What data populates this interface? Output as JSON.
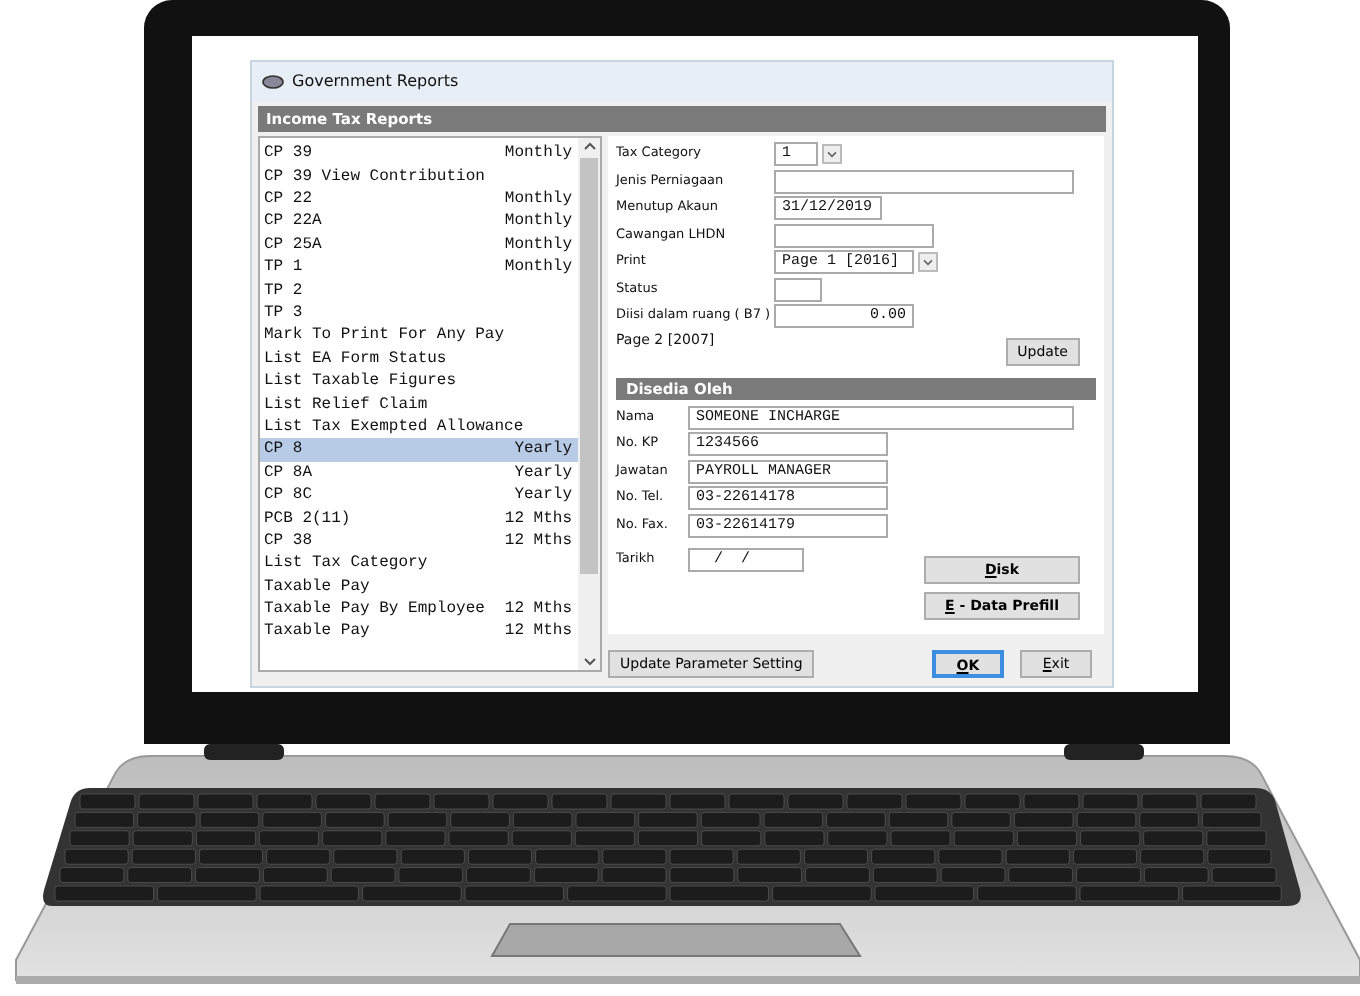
{
  "window": {
    "title": "Government Reports"
  },
  "section_title": "Income Tax Reports",
  "reports": [
    {
      "name": "CP 39",
      "period": "Monthly",
      "selected": false
    },
    {
      "name": "CP 39 View Contribution",
      "selected": false
    },
    {
      "name": "CP 22",
      "period": "Monthly",
      "selected": false
    },
    {
      "name": "CP 22A",
      "period": "Monthly",
      "selected": false
    },
    {
      "name": "CP 25A",
      "period": "Monthly",
      "selected": false
    },
    {
      "name": "TP 1",
      "period": "Monthly",
      "selected": false
    },
    {
      "name": "TP 2",
      "selected": false
    },
    {
      "name": "TP 3",
      "selected": false
    },
    {
      "name": "Mark To Print For Any Pay",
      "selected": false
    },
    {
      "name": "List EA Form Status",
      "selected": false
    },
    {
      "name": "List Taxable Figures",
      "selected": false
    },
    {
      "name": "List Relief Claim",
      "selected": false
    },
    {
      "name": "List Tax Exempted Allowance",
      "selected": false
    },
    {
      "name": "CP 8",
      "period": "Yearly",
      "selected": true
    },
    {
      "name": "CP 8A",
      "period": "Yearly",
      "selected": false
    },
    {
      "name": "CP 8C",
      "period": "Yearly",
      "selected": false
    },
    {
      "name": "PCB 2(11)",
      "period": "12 Mths",
      "selected": false
    },
    {
      "name": "CP 38",
      "period": "12 Mths",
      "selected": false
    },
    {
      "name": "List Tax Category",
      "selected": false
    },
    {
      "name": "Taxable Pay",
      "selected": false
    },
    {
      "name": "Taxable Pay By Employee",
      "period": "12 Mths",
      "selected": false
    },
    {
      "name": "Taxable Pay",
      "period": "12 Mths",
      "selected": false
    }
  ],
  "tax_fields": [
    {
      "label": "Tax Category",
      "kind": "dropdown",
      "value": "1"
    },
    {
      "label": "Jenis Perniagaan",
      "kind": "text"
    },
    {
      "label": "Menutup Akaun",
      "kind": "text",
      "value": "31/12/2019"
    },
    {
      "label": "Cawangan LHDN",
      "kind": "text"
    },
    {
      "label": "Print",
      "kind": "dropdown",
      "value": "Page 1 [2016]"
    },
    {
      "label": "Status",
      "kind": "text"
    },
    {
      "label": "Diisi dalam ruang ( B7 )",
      "kind": "number",
      "value": "0.00"
    }
  ],
  "page_note": "Page 2 [2007]",
  "update_button": "Update",
  "prepared_by": {
    "title": "Disedia Oleh",
    "fields": [
      {
        "label": "Nama",
        "value": "SOMEONE INCHARGE"
      },
      {
        "label": "No. KP",
        "value": "1234566"
      },
      {
        "label": "Jawatan",
        "value": "PAYROLL MANAGER"
      },
      {
        "label": "No. Tel.",
        "value": "03-22614178"
      },
      {
        "label": "No. Fax.",
        "value": "03-22614179"
      }
    ],
    "date": {
      "label": "Tarikh",
      "value": "  /  /"
    }
  },
  "side_buttons": [
    "Disk",
    "E - Data Prefill"
  ],
  "footer_buttons": [
    {
      "label": "Update Parameter Setting",
      "focused": false
    },
    {
      "label": "OK",
      "focused": true
    },
    {
      "label": "Exit",
      "focused": false
    }
  ]
}
